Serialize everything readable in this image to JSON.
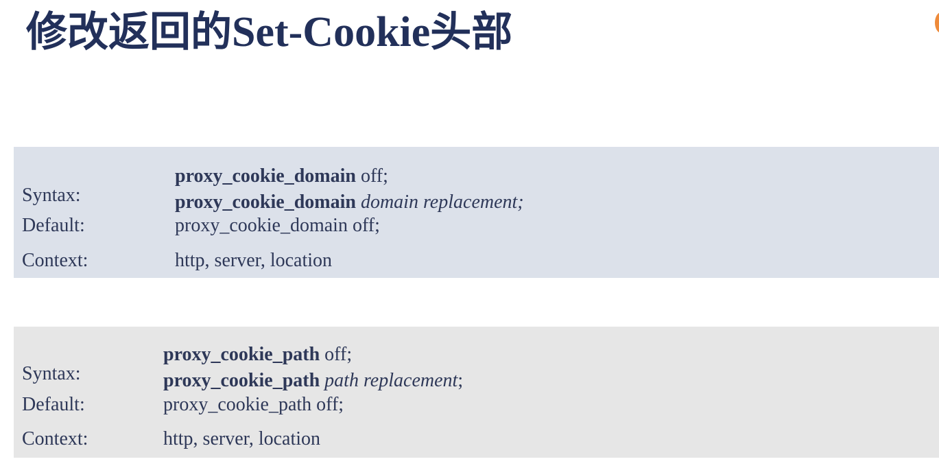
{
  "title": {
    "prefix": "修改返回的",
    "latin": "Set-Cookie",
    "suffix": "头部"
  },
  "blocks": [
    {
      "syntax_label": "Syntax:",
      "syntax_lines": [
        {
          "directive": "proxy_cookie_domain",
          "args": " off;",
          "args_italic": "",
          "tail": ""
        },
        {
          "directive": "proxy_cookie_domain",
          "args": " ",
          "args_italic": "domain replacement;",
          "tail": ""
        }
      ],
      "default_label": "Default:",
      "default_value": "proxy_cookie_domain off;",
      "context_label": "Context:",
      "context_value": "http, server, location"
    },
    {
      "syntax_label": "Syntax:",
      "syntax_lines": [
        {
          "directive": "proxy_cookie_path",
          "args": " off;",
          "args_italic": "",
          "tail": ""
        },
        {
          "directive": "proxy_cookie_path",
          "args": " ",
          "args_italic": "path replacement",
          "tail": ";"
        }
      ],
      "default_label": "Default:",
      "default_value": "proxy_cookie_path off;",
      "context_label": "Context:",
      "context_value": "http, server, location"
    }
  ],
  "colors": {
    "title": "#22305a",
    "text": "#2e3858",
    "block_domain_bg": "#dce1ea",
    "block_path_bg": "#e6e6e6",
    "accent": "#ee8a3a"
  }
}
